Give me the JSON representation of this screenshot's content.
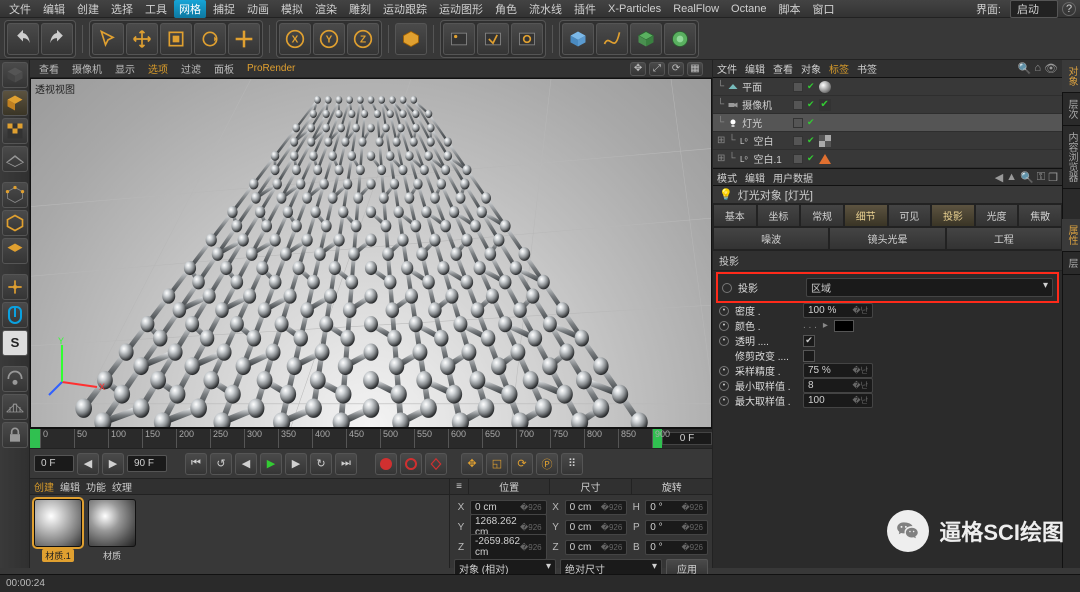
{
  "menu": {
    "items": [
      "文件",
      "编辑",
      "创建",
      "选择",
      "工具",
      "网格",
      "捕捉",
      "动画",
      "模拟",
      "渲染",
      "雕刻",
      "运动跟踪",
      "运动图形",
      "角色",
      "流水线",
      "插件",
      "X-Particles",
      "RealFlow",
      "Octane",
      "脚本",
      "窗口"
    ],
    "ui_label": "界面:",
    "layout": "启动",
    "highlight": 5
  },
  "viewportMenu": {
    "items": [
      "查看",
      "摄像机",
      "显示",
      "选项",
      "过滤",
      "面板",
      "ProRender"
    ],
    "highlight": 3,
    "overlay": "透视视图"
  },
  "timeline": {
    "ticks": [
      0,
      50,
      100,
      150,
      200,
      250,
      300,
      350,
      400,
      450,
      500,
      550,
      600,
      650,
      700,
      750,
      800,
      850,
      900
    ],
    "start": "0 F",
    "end": "0 F",
    "startField": "0 F",
    "endField": "90 F"
  },
  "materials": {
    "menu": [
      "创建",
      "编辑",
      "功能",
      "纹理"
    ],
    "hl": 0,
    "items": [
      {
        "label": "材质.1"
      },
      {
        "label": "材质"
      }
    ]
  },
  "coord": {
    "headers": [
      "位置",
      "尺寸",
      "旋转"
    ],
    "rows": [
      {
        "a": "X",
        "av": "0 cm",
        "b": "X",
        "bv": "0 cm",
        "c": "H",
        "cv": "0 °"
      },
      {
        "a": "Y",
        "av": "1268.262 cm",
        "b": "Y",
        "bv": "0 cm",
        "c": "P",
        "cv": "0 °"
      },
      {
        "a": "Z",
        "av": "-2659.862 cm",
        "b": "Z",
        "bv": "0 cm",
        "c": "B",
        "cv": "0 °"
      }
    ],
    "mode1": "对象 (相对)",
    "mode2": "绝对尺寸",
    "apply": "应用"
  },
  "objPanel": {
    "menu": [
      "文件",
      "编辑",
      "查看",
      "对象",
      "标签",
      "书签"
    ],
    "hl": 4,
    "rows": [
      {
        "icon": "plane",
        "label": "平面",
        "tag": "sphere"
      },
      {
        "icon": "cam",
        "label": "摄像机",
        "tag": "check"
      },
      {
        "icon": "light",
        "label": "灯光",
        "sel": true
      },
      {
        "icon": "null",
        "label": "空白",
        "tag": "tex"
      },
      {
        "icon": "null",
        "label": "空白.1",
        "tag": "tri"
      }
    ]
  },
  "attr": {
    "menu": [
      "模式",
      "编辑",
      "用户数据"
    ],
    "title": "灯光对象 [灯光]",
    "tabs": [
      "基本",
      "坐标",
      "常规",
      "细节",
      "可见",
      "投影",
      "光度",
      "焦散",
      "噪波",
      "镜头光晕",
      "工程"
    ],
    "activeTabs": [
      3,
      5
    ],
    "section": "投影",
    "shadow": {
      "label": "投影",
      "value": "区域"
    },
    "rows": [
      {
        "label": "密度",
        "value": "100 %",
        "kind": "num"
      },
      {
        "label": "颜色",
        "kind": "color"
      },
      {
        "label": "透明",
        "kind": "check",
        "checked": true
      },
      {
        "label": "修剪改变",
        "kind": "check",
        "checked": false,
        "noBullet": true
      },
      {
        "label": "采样精度",
        "value": "75 %",
        "kind": "num"
      },
      {
        "label": "最小取样值",
        "value": "8",
        "kind": "num"
      },
      {
        "label": "最大取样值",
        "value": "100",
        "kind": "num"
      }
    ]
  },
  "status": "00:00:24",
  "watermark": "逼格SCI绘图",
  "sideTabs": [
    "对象",
    "层次",
    "内容浏览器"
  ],
  "sideTabs2": [
    "属性",
    "层"
  ]
}
